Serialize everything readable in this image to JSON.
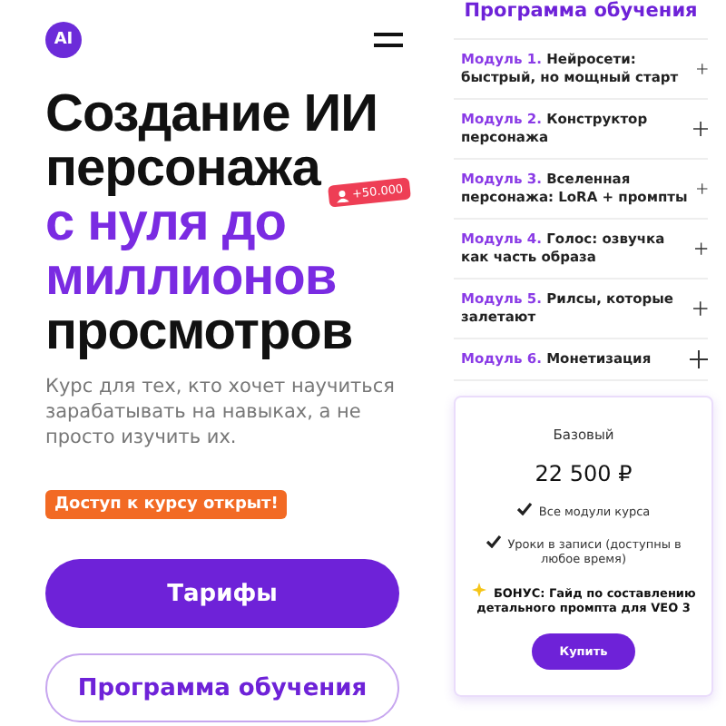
{
  "logo": {
    "text": "AI"
  },
  "heading": [
    {
      "text": "Создание ИИ",
      "accent": false
    },
    {
      "text": "персонажа",
      "accent": false
    },
    {
      "text": "с нуля до",
      "accent": true
    },
    {
      "text": "миллионов",
      "accent": true
    },
    {
      "text": "просмотров",
      "accent": false
    }
  ],
  "follower_badge": "+50.000",
  "subtitle": "Курс для тех, кто хочет научиться зарабатывать на навыках, а не просто изучить их.",
  "access_tag": "Доступ к курсу открыт!",
  "buttons": [
    {
      "label": "Тарифы",
      "kind": "primary"
    },
    {
      "label": "Программа обучения",
      "kind": "outline"
    }
  ],
  "program": {
    "title": "Программа обучения",
    "modules": [
      {
        "number": "Модуль 1.",
        "title": "Нейросети: быстрый, но мощный старт"
      },
      {
        "number": "Модуль 2.",
        "title": "Конструктор персонажа"
      },
      {
        "number": "Модуль 3.",
        "title": "Вселенная персонажа: LoRA + промпты"
      },
      {
        "number": "Модуль 4.",
        "title": "Голос: озвучка как часть образа"
      },
      {
        "number": "Модуль 5.",
        "title": "Рилсы, которые залетают"
      },
      {
        "number": "Модуль 6.",
        "title": "Монетизация"
      }
    ]
  },
  "plan": {
    "name": "Базовый",
    "price": "22 500 ₽",
    "features": [
      {
        "text": "Все модули курса",
        "kind": "check"
      },
      {
        "text": "Уроки в записи (доступны в любое время)",
        "kind": "check"
      },
      {
        "text": "БОНУС: Гайд по составлению детального промпта для VEO 3",
        "kind": "bonus"
      }
    ],
    "button": "Купить"
  }
}
